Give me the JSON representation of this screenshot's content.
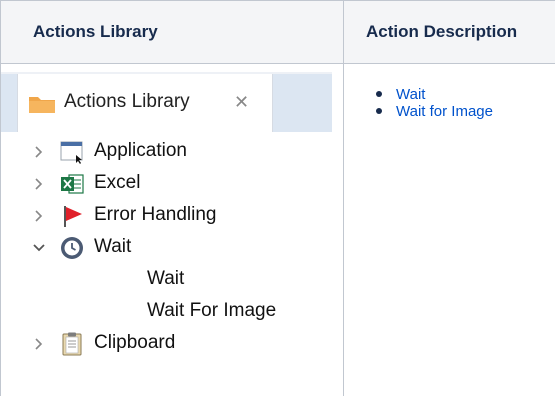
{
  "table": {
    "headers": [
      "Actions Library",
      "Action Description"
    ]
  },
  "panel": {
    "tab_title": "Actions Library",
    "tab_close_glyph": "✕",
    "tree": [
      {
        "label": "Application",
        "icon": "application-window-icon",
        "expanded": false
      },
      {
        "label": "Excel",
        "icon": "excel-icon",
        "expanded": false
      },
      {
        "label": "Error Handling",
        "icon": "red-flag-icon",
        "expanded": false
      },
      {
        "label": "Wait",
        "icon": "clock-icon",
        "expanded": true,
        "children": [
          {
            "label": "Wait"
          },
          {
            "label": "Wait For Image"
          }
        ]
      },
      {
        "label": "Clipboard",
        "icon": "clipboard-icon",
        "expanded": false
      }
    ]
  },
  "description": {
    "links": [
      "Wait",
      "Wait for Image"
    ]
  },
  "colors": {
    "link": "#0052cc",
    "header_bg": "#f4f5f7",
    "border": "#c1c7d0",
    "tab_bar": "#dce6f2",
    "folder": "#f0a64a",
    "excel": "#1d7745",
    "flag": "#e0202a",
    "clock": "#4b5a73"
  }
}
